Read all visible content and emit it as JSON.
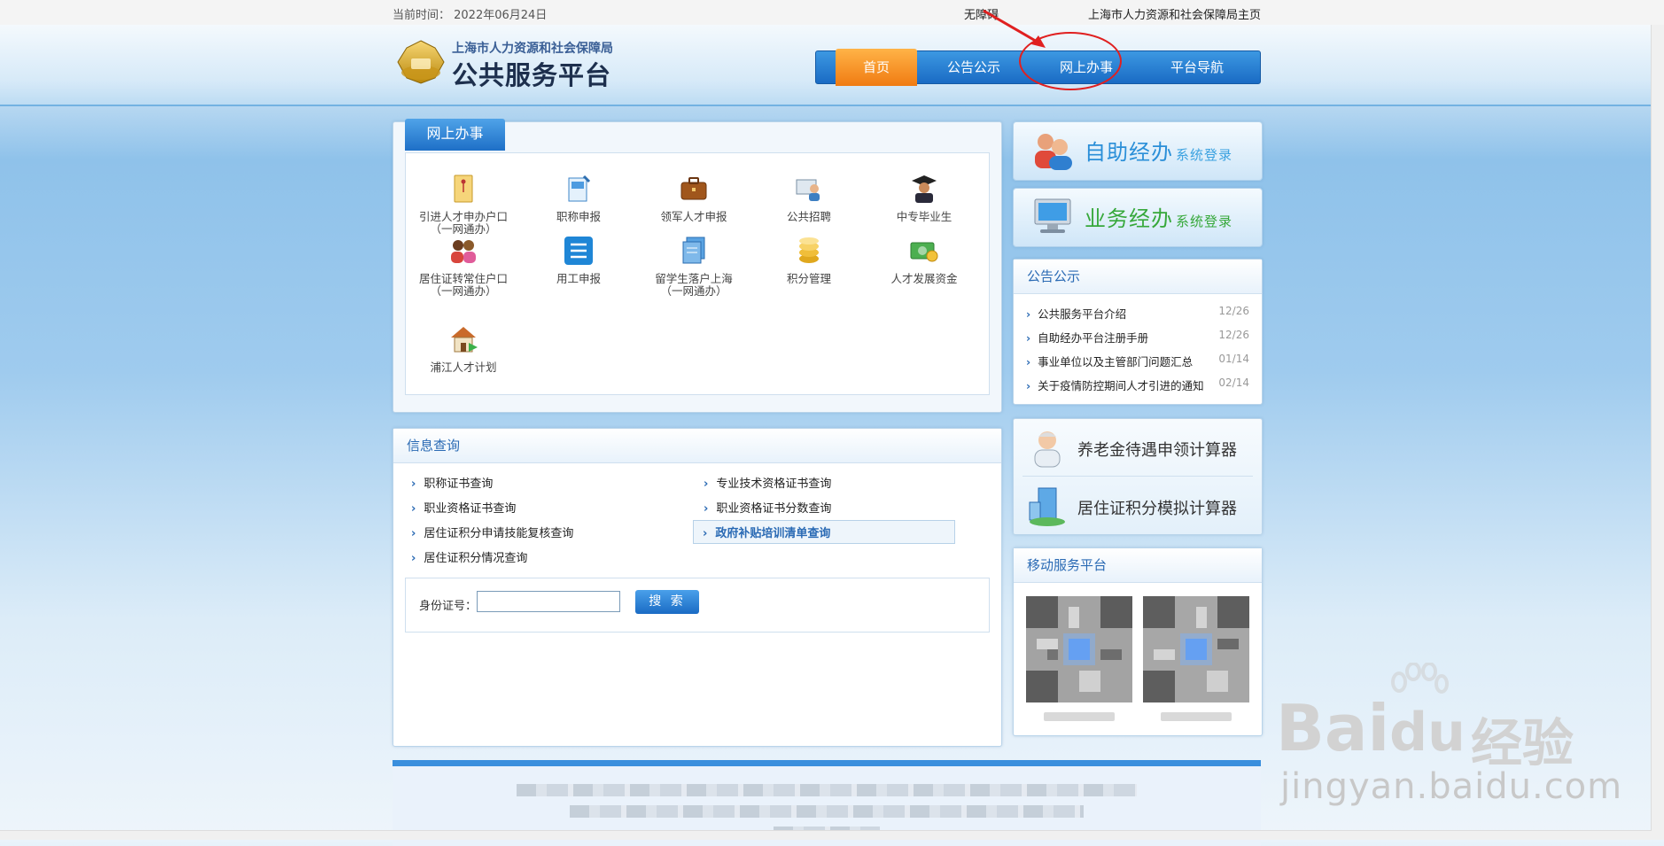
{
  "topbar": {
    "date": "当前时间：  2022年06月24日",
    "accessibility": "无障碍",
    "main_site": "上海市人力资源和社会保障局主页"
  },
  "logo": {
    "org": "上海市人力资源和社会保障局",
    "title": "公共服务平台"
  },
  "nav": {
    "items": [
      "首页",
      "公告公示",
      "网上办事",
      "平台导航"
    ],
    "active": "首页",
    "active_color": "#f07b12"
  },
  "online_services": {
    "tab": "网上办事",
    "items": [
      {
        "label": "引进人才申办户口",
        "sub": "（一网通办）",
        "icon": "folder-icon"
      },
      {
        "label": "职称申报",
        "sub": "",
        "icon": "document-pen-icon"
      },
      {
        "label": "领军人才申报",
        "sub": "",
        "icon": "briefcase-icon"
      },
      {
        "label": "公共招聘",
        "sub": "",
        "icon": "recruit-icon"
      },
      {
        "label": "中专毕业生",
        "sub": "",
        "icon": "graduate-icon"
      },
      {
        "label": "居住证转常住户口",
        "sub": "（一网通办）",
        "icon": "people-icon"
      },
      {
        "label": "用工申报",
        "sub": "",
        "icon": "list-icon"
      },
      {
        "label": "留学生落户上海",
        "sub": "（一网通办）",
        "icon": "documents-icon"
      },
      {
        "label": "积分管理",
        "sub": "",
        "icon": "coins-icon"
      },
      {
        "label": "人才发展资金",
        "sub": "",
        "icon": "money-icon"
      },
      {
        "label": "浦江人才计划",
        "sub": "",
        "icon": "house-icon"
      }
    ]
  },
  "info_query": {
    "title": "信息查询",
    "left_links": [
      "职称证书查询",
      "职业资格证书查询",
      "居住证积分申请技能复核查询",
      "居住证积分情况查询"
    ],
    "right_links": [
      "专业技术资格证书查询",
      "职业资格证书分数查询",
      "政府补贴培训清单查询"
    ],
    "id_label": "身份证号：",
    "id_value": "",
    "search_button": "搜 索"
  },
  "login": {
    "self": {
      "big": "自助经办",
      "small": "系统登录"
    },
    "business": {
      "big": "业务经办",
      "small": "系统登录"
    }
  },
  "notices": {
    "title": "公告公示",
    "items": [
      {
        "title": "公共服务平台介绍",
        "date": "12/26"
      },
      {
        "title": "自助经办平台注册手册",
        "date": "12/26"
      },
      {
        "title": "事业单位以及主管部门问题汇总",
        "date": "01/14"
      },
      {
        "title": "关于疫情防控期间人才引进的通知",
        "date": "02/14"
      }
    ]
  },
  "calculators": {
    "pension": "养老金待遇申领计算器",
    "points": "居住证积分模拟计算器"
  },
  "mobile": {
    "title": "移动服务平台"
  },
  "watermark": {
    "brand": "Bai",
    "brand2": "du",
    "jy": "经验",
    "url": "jingyan.baidu.com"
  }
}
